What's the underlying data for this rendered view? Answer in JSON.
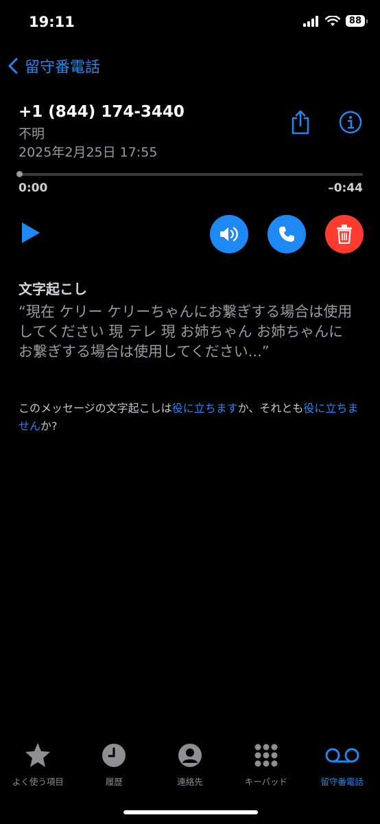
{
  "status_bar": {
    "time": "19:11",
    "battery": "88"
  },
  "nav": {
    "back_label": "留守番電話"
  },
  "voicemail": {
    "phone_number": "+1 (844) 174-3440",
    "caller_label": "不明",
    "date": "2025年2月25日 17:55",
    "elapsed": "0:00",
    "remaining": "–0:44",
    "progress": 0
  },
  "transcription": {
    "title": "文字起こし",
    "text": "“現在 ケリー ケリーちゃんにお繋ぎする場合は使用してください 現 テレ 現 お姉ちゃん お姉ちゃんにお繋ぎする場合は使用してください...”",
    "feedback_prefix": "このメッセージの文字起こしは",
    "feedback_useful": "役に立ちます",
    "feedback_middle": "か、それとも",
    "feedback_not_useful": "役に立ちません",
    "feedback_suffix": "か?"
  },
  "tabs": [
    {
      "label": "よく使う項目",
      "icon": "star-icon"
    },
    {
      "label": "履歴",
      "icon": "clock-icon"
    },
    {
      "label": "連絡先",
      "icon": "person-icon"
    },
    {
      "label": "キーパッド",
      "icon": "keypad-icon"
    },
    {
      "label": "留守番電話",
      "icon": "voicemail-icon",
      "active": true
    }
  ],
  "colors": {
    "accent": "#1e88f5",
    "delete": "#ff3b30",
    "secondary_text": "#9a9a9f"
  }
}
